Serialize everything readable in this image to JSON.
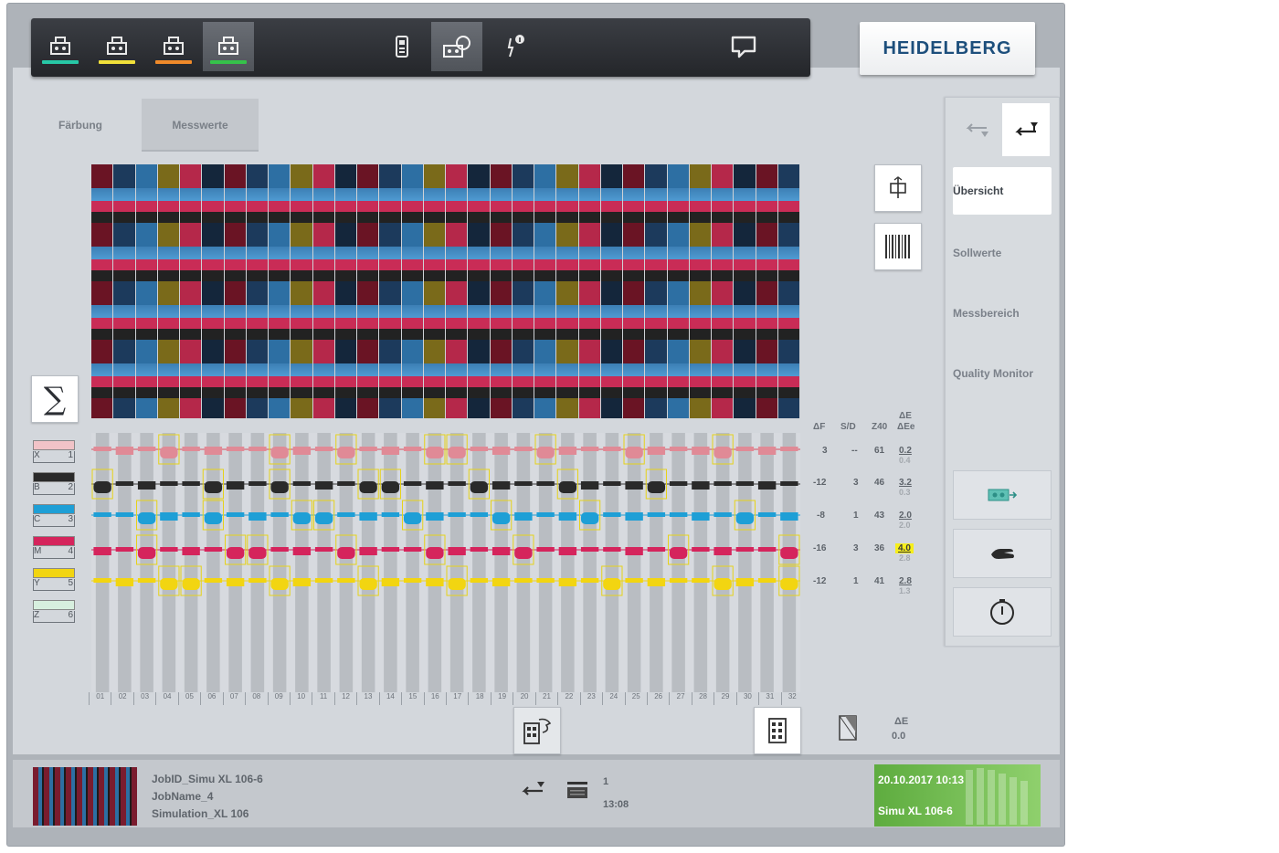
{
  "brand": {
    "logo": "HEIDELBERG"
  },
  "colors": {
    "cyan": "#1e9fd6",
    "yellow": "#f2d511",
    "magenta": "#d5245c",
    "black": "#2a2a2a",
    "x_color": "#e7a4ac",
    "z_color": "#cfe9d8",
    "active_green": "#4ea83a"
  },
  "toolbar": {
    "units": [
      {
        "icon": "printing-unit-icon",
        "bar_color": "#27c7a6"
      },
      {
        "icon": "printing-unit-icon",
        "bar_color": "#f1e03a"
      },
      {
        "icon": "printing-unit-icon",
        "bar_color": "#f08a2a"
      },
      {
        "icon": "printing-unit-icon",
        "bar_color": "#35c24a"
      }
    ],
    "center_icons": [
      "handheld-device-icon",
      "measure-console-icon",
      "alert-info-icon"
    ],
    "right_icon": "message-icon"
  },
  "tabs": [
    {
      "label": "Färbung"
    },
    {
      "label": "Messwerte"
    }
  ],
  "legend": [
    {
      "letter": "X",
      "num": "1",
      "color": "#f1c3c7"
    },
    {
      "letter": "B",
      "num": "2",
      "color": "#2a2a2a"
    },
    {
      "letter": "C",
      "num": "3",
      "color": "#1e9fd6"
    },
    {
      "letter": "M",
      "num": "4",
      "color": "#d5245c"
    },
    {
      "letter": "Y",
      "num": "5",
      "color": "#f2d511"
    },
    {
      "letter": "Z",
      "num": "6",
      "color": "#d7efde"
    }
  ],
  "right_table": {
    "headers": {
      "df": "ΔF",
      "sd": "S/D",
      "z40": "Z40",
      "de": "ΔE",
      "de2": "ΔEe"
    },
    "rows": [
      {
        "df": "3",
        "sd": "--",
        "z40": "61",
        "de": "0.2",
        "de2": "0.4"
      },
      {
        "df": "-12",
        "sd": "3",
        "z40": "46",
        "de": "3.2",
        "de2": "0.3"
      },
      {
        "df": "-8",
        "sd": "1",
        "z40": "43",
        "de": "2.0",
        "de2": "2.0"
      },
      {
        "df": "-16",
        "sd": "3",
        "z40": "36",
        "de": "4.0",
        "de2": "2.8",
        "highlight": true
      },
      {
        "df": "-12",
        "sd": "1",
        "z40": "41",
        "de": "2.8",
        "de2": "1.3"
      }
    ]
  },
  "zones": [
    "01",
    "02",
    "03",
    "04",
    "05",
    "06",
    "07",
    "08",
    "09",
    "10",
    "11",
    "12",
    "13",
    "14",
    "15",
    "16",
    "17",
    "18",
    "19",
    "20",
    "21",
    "22",
    "23",
    "24",
    "25",
    "26",
    "27",
    "28",
    "29",
    "30",
    "31",
    "32"
  ],
  "bottom_controls": {
    "delta_e_label": "ΔE",
    "delta_e_value": "0.0"
  },
  "side_panel": {
    "nav": [
      {
        "label": "Übersicht",
        "active": true
      },
      {
        "label": "Sollwerte"
      },
      {
        "label": "Messbereich"
      },
      {
        "label": "Quality Monitor"
      }
    ],
    "buttons": [
      "ink-zones-icon",
      "hand-icon",
      "timer-icon"
    ]
  },
  "job": {
    "job_id": "JobID_Simu XL 106-6",
    "job_name": "JobName_4",
    "simulation": "Simulation_XL 106"
  },
  "bottom_center": {
    "count": "1",
    "time": "13:08"
  },
  "status": {
    "datetime": "20.10.2017 10:13",
    "machine": "Simu XL 106-6"
  }
}
